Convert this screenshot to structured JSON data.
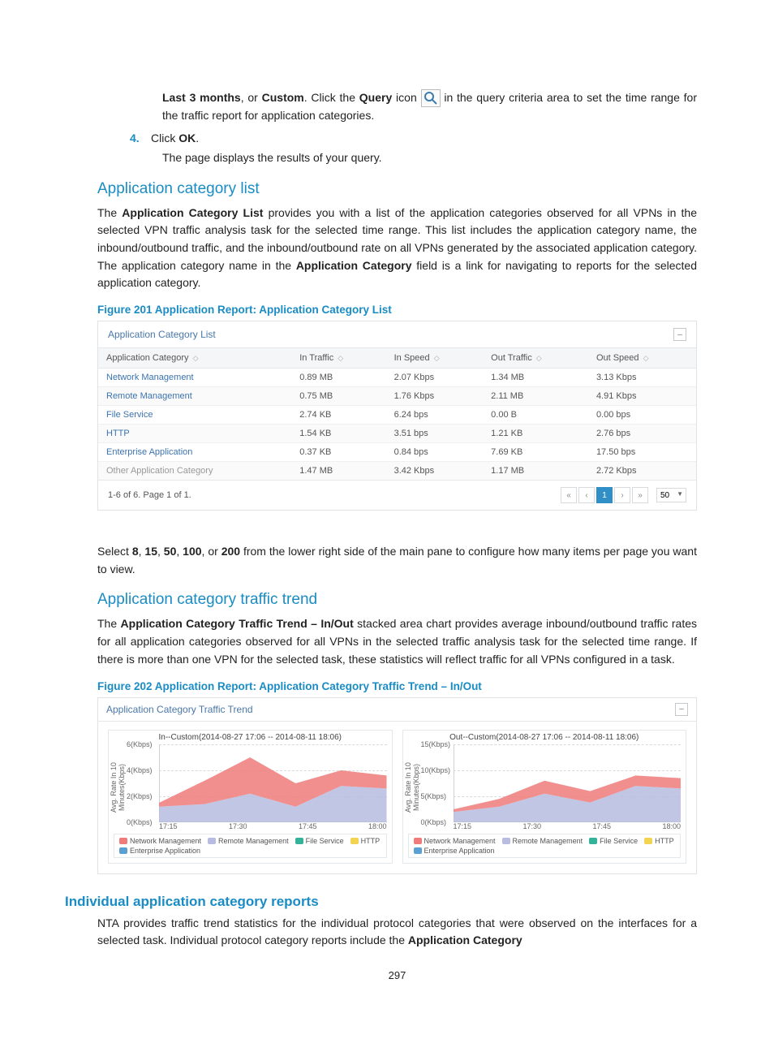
{
  "intro_line": {
    "pre": "Last 3 months",
    "sep1": ", or ",
    "custom": "Custom",
    "sep2": ". Click the ",
    "query": "Query",
    "mid": " icon ",
    "tail": " in the query criteria area to set the time range for the traffic report for application categories."
  },
  "step4": {
    "num": "4.",
    "text_pre": "Click ",
    "text_bold": "OK",
    "text_post": ".",
    "sub": "The page displays the results of your query."
  },
  "sec1": {
    "heading": "Application category list",
    "para_a": "The ",
    "para_b": "Application Category List",
    "para_c": " provides you with a list of the application categories observed for all VPNs in the selected VPN traffic analysis task for the selected time range. This list includes the application category name, the inbound/outbound traffic, and the inbound/outbound rate on all VPNs generated by the associated application category. The application category name in the ",
    "para_d": "Application Category",
    "para_e": " field is a link for navigating to reports for the selected application category.",
    "fig_caption": "Figure 201 Application Report: Application Category List"
  },
  "fig201": {
    "title": "Application Category List",
    "headers": [
      "Application Category",
      "In Traffic",
      "In Speed",
      "Out Traffic",
      "Out Speed"
    ],
    "rows": [
      {
        "cat": "Network Management",
        "inT": "0.89 MB",
        "inS": "2.07 Kbps",
        "outT": "1.34 MB",
        "outS": "3.13 Kbps",
        "link": true
      },
      {
        "cat": "Remote Management",
        "inT": "0.75 MB",
        "inS": "1.76 Kbps",
        "outT": "2.11 MB",
        "outS": "4.91 Kbps",
        "link": true
      },
      {
        "cat": "File Service",
        "inT": "2.74 KB",
        "inS": "6.24 bps",
        "outT": "0.00 B",
        "outS": "0.00 bps",
        "link": true
      },
      {
        "cat": "HTTP",
        "inT": "1.54 KB",
        "inS": "3.51 bps",
        "outT": "1.21 KB",
        "outS": "2.76 bps",
        "link": true
      },
      {
        "cat": "Enterprise Application",
        "inT": "0.37 KB",
        "inS": "0.84 bps",
        "outT": "7.69 KB",
        "outS": "17.50 bps",
        "link": true
      },
      {
        "cat": "Other Application Category",
        "inT": "1.47 MB",
        "inS": "3.42 Kbps",
        "outT": "1.17 MB",
        "outS": "2.72 Kbps",
        "link": false
      }
    ],
    "pager_text": "1-6 of 6. Page 1 of 1.",
    "page_size_options": [
      "8",
      "15",
      "50",
      "100",
      "200"
    ],
    "page_size": "50",
    "current_page": "1"
  },
  "after_table": {
    "a": "Select ",
    "b": "8",
    "c": ", ",
    "d": "15",
    "e": ", ",
    "f": "50",
    "g": ", ",
    "h": "100",
    "i": ", or ",
    "j": "200",
    "k": " from the lower right side of the main pane to configure how many items per page you want to view."
  },
  "sec2": {
    "heading": "Application category traffic trend",
    "para_a": "The ",
    "para_b": "Application Category Traffic Trend – In/Out",
    "para_c": " stacked area chart provides average inbound/outbound traffic rates for all application categories observed for all VPNs in the selected traffic analysis task for the selected time range. If there is more than one VPN for the selected task, these statistics will reflect traffic for all VPNs configured in a task.",
    "fig_caption": "Figure 202 Application Report: Application Category Traffic Trend – In/Out"
  },
  "fig202": {
    "title": "Application Category Traffic Trend",
    "in_title": "In--Custom(2014-08-27 17:06 -- 2014-08-11 18:06)",
    "out_title": "Out--Custom(2014-08-27 17:06 -- 2014-08-11 18:06)",
    "ylabel": "Avg. Rate In 10 Minutes(Kbps)",
    "xticks": [
      "17:15",
      "17:30",
      "17:45",
      "18:00"
    ],
    "in_yticks": [
      "0(Kbps)",
      "2(Kbps)",
      "4(Kbps)",
      "6(Kbps)"
    ],
    "out_yticks": [
      "0(Kbps)",
      "5(Kbps)",
      "10(Kbps)",
      "15(Kbps)"
    ],
    "legend": [
      "Network Management",
      "Remote Management",
      "File Service",
      "HTTP",
      "Enterprise Application"
    ],
    "colors": {
      "network": "#ef7b7b",
      "remote": "#b7bce0",
      "file": "#34b39a",
      "http": "#f2d452",
      "enterprise": "#5aa0d2"
    }
  },
  "sec3": {
    "heading": "Individual application category reports",
    "para_a": "NTA provides traffic trend statistics for the individual protocol categories that were observed on the interfaces for a selected task. Individual protocol category reports include the ",
    "para_b": "Application Category"
  },
  "page_number": "297",
  "chart_data": [
    {
      "type": "area",
      "title": "In--Custom(2014-08-27 17:06 -- 2014-08-11 18:06)",
      "xlabel": "",
      "ylabel": "Avg. Rate In 10 Minutes(Kbps)",
      "ylim": [
        0,
        6
      ],
      "x": [
        "17:06",
        "17:15",
        "17:30",
        "17:45",
        "18:00",
        "18:06"
      ],
      "series": [
        {
          "name": "Network Management",
          "values": [
            1.5,
            3.2,
            5.0,
            3.0,
            4.0,
            3.6
          ]
        },
        {
          "name": "Remote Management",
          "values": [
            1.2,
            1.4,
            2.2,
            1.2,
            2.8,
            2.6
          ]
        },
        {
          "name": "File Service",
          "values": [
            0.0,
            0.0,
            0.0,
            0.0,
            0.0,
            0.0
          ]
        },
        {
          "name": "HTTP",
          "values": [
            0.0,
            0.0,
            0.0,
            0.0,
            0.0,
            0.0
          ]
        },
        {
          "name": "Enterprise Application",
          "values": [
            0.0,
            0.0,
            0.0,
            0.0,
            0.0,
            0.0
          ]
        }
      ]
    },
    {
      "type": "area",
      "title": "Out--Custom(2014-08-27 17:06 -- 2014-08-11 18:06)",
      "xlabel": "",
      "ylabel": "Avg. Rate In 10 Minutes(Kbps)",
      "ylim": [
        0,
        15
      ],
      "x": [
        "17:06",
        "17:15",
        "17:30",
        "17:45",
        "18:00",
        "18:06"
      ],
      "series": [
        {
          "name": "Network Management",
          "values": [
            2.5,
            4.5,
            8.0,
            6.0,
            9.0,
            8.5
          ]
        },
        {
          "name": "Remote Management",
          "values": [
            2.0,
            3.0,
            5.5,
            3.8,
            7.0,
            6.5
          ]
        },
        {
          "name": "File Service",
          "values": [
            0.0,
            0.0,
            0.0,
            0.0,
            0.0,
            0.0
          ]
        },
        {
          "name": "HTTP",
          "values": [
            0.0,
            0.0,
            0.0,
            0.0,
            0.0,
            0.0
          ]
        },
        {
          "name": "Enterprise Application",
          "values": [
            0.0,
            0.0,
            0.0,
            0.0,
            0.0,
            0.0
          ]
        }
      ]
    }
  ]
}
